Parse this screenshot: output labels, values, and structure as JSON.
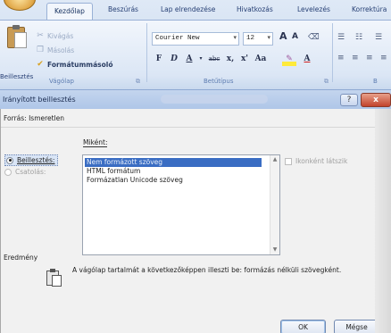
{
  "ribbon": {
    "tabs": [
      {
        "label": "Kezdőlap",
        "active": true
      },
      {
        "label": "Beszúrás"
      },
      {
        "label": "Lap elrendezése"
      },
      {
        "label": "Hivatkozás"
      },
      {
        "label": "Levelezés"
      },
      {
        "label": "Korrektúra"
      }
    ],
    "clipboard": {
      "paste_label": "Beillesztés",
      "cut_label": "Kivágás",
      "copy_label": "Másolás",
      "format_painter_label": "Formátummásoló",
      "group_label": "Vágólap"
    },
    "font": {
      "font_name": "Courier New",
      "font_size": "12",
      "group_label": "Betűtípus",
      "bold": "F",
      "italic": "D",
      "underline": "A",
      "strikethrough": "abc",
      "subscript": "x,",
      "superscript": "x'",
      "change_case": "Aa",
      "grow": "A",
      "shrink": "A"
    },
    "paragraph_group_label": "B"
  },
  "dialog": {
    "title": "Irányított beillesztés",
    "help": "?",
    "close": "x",
    "source": "Forrás:  Ismeretlen",
    "as_label": "Miként:",
    "paste_radio": "Beillesztés:",
    "link_radio": "Csatolás:",
    "list_items": [
      "Nem formázott szöveg",
      "HTML formátum",
      "Formázatlan Unicode szöveg"
    ],
    "show_as_icon": "Ikonként látszik",
    "result_label": "Eredmény",
    "result_text": "A vágólap tartalmát a következőképpen illeszti be: formázás nélküli szövegként.",
    "ok": "OK",
    "cancel": "Mégse"
  }
}
